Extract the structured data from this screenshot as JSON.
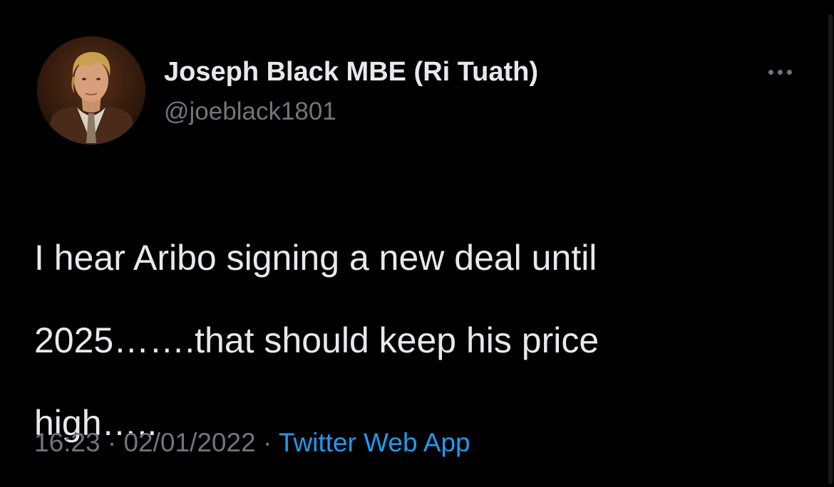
{
  "tweet": {
    "author": {
      "display_name": "Joseph Black MBE (Ri Tuath)",
      "handle": "@joeblack1801"
    },
    "text_lines": [
      "I hear Aribo signing a new deal until",
      "2025…….that should keep his price",
      "high….."
    ],
    "time": "16:23",
    "date": "02/01/2022",
    "separator": "·",
    "source": "Twitter Web App",
    "more_icon": "more-horizontal-icon"
  },
  "colors": {
    "background": "#000000",
    "primary_text": "#e7e9ea",
    "secondary_text": "#71767b",
    "link": "#1d9bf0"
  }
}
